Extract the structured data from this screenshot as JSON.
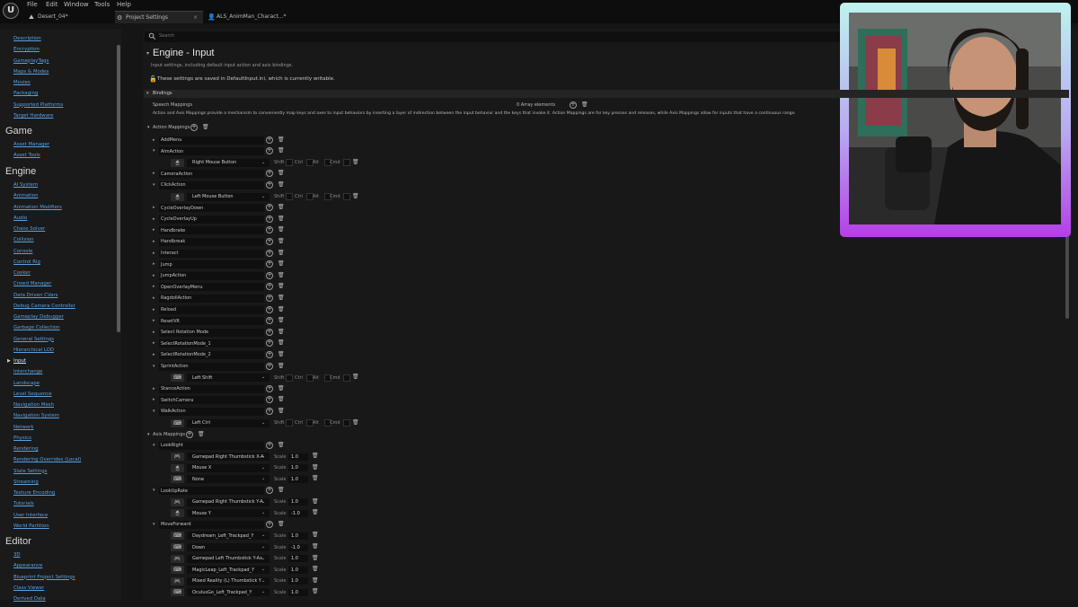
{
  "menu": [
    "File",
    "Edit",
    "Window",
    "Tools",
    "Help"
  ],
  "tabs": [
    {
      "label": "Desert_04*",
      "icon": "⛰"
    },
    {
      "label": "Project Settings",
      "icon": "⚙"
    },
    {
      "label": "ALS_AnimMan_Charact...*",
      "icon": "👤"
    }
  ],
  "sidebar": {
    "top_links": [
      "Description",
      "Encryption",
      "GameplayTags",
      "Maps & Modes",
      "Movies",
      "Packaging",
      "Supported Platforms",
      "Target Hardware"
    ],
    "sections": [
      {
        "title": "Game",
        "links": [
          "Asset Manager",
          "Asset Tools"
        ]
      },
      {
        "title": "Engine",
        "links": [
          "AI System",
          "Animation",
          "Animation Modifiers",
          "Audio",
          "Chaos Solver",
          "Collision",
          "Console",
          "Control Rig",
          "Cooker",
          "Crowd Manager",
          "Data Driven CVars",
          "Debug Camera Controller",
          "Gameplay Debugger",
          "Garbage Collection",
          "General Settings",
          "Hierarchical LOD",
          "Input",
          "Interchange",
          "Landscape",
          "Level Sequence",
          "Navigation Mesh",
          "Navigation System",
          "Network",
          "Physics",
          "Rendering",
          "Rendering Overrides (Local)",
          "Slate Settings",
          "Streaming",
          "Texture Encoding",
          "Tutorials",
          "User Interface",
          "World Partition"
        ]
      },
      {
        "title": "Editor",
        "links": [
          "3D",
          "Appearance",
          "Blueprint Project Settings",
          "Class Viewer",
          "Derived Data"
        ]
      }
    ]
  },
  "search": {
    "placeholder": "Search"
  },
  "page": {
    "title": "Engine - Input",
    "subtitle": "Input settings, including default input action and axis bindings.",
    "notice": "These settings are saved in DefaultInput.ini, which is currently writable."
  },
  "bindings": {
    "header": "Bindings",
    "speech_label": "Speech Mappings",
    "speech_count": "0 Array elements",
    "description": "Action and Axis Mappings provide a mechanism to conveniently map keys and axes to input behaviors by inserting a layer of indirection between the input behavior and the keys that invoke it. Action Mappings are for key presses and releases, while Axis Mappings allow for inputs that have a continuous range.",
    "action_header": "Action Mappings",
    "axis_header": "Axis Mappings",
    "modifiers": [
      "Shift",
      "Ctrl",
      "Alt",
      "Cmd"
    ],
    "scale_label": "Scale"
  },
  "action_mappings": [
    {
      "name": "AddMenu",
      "expanded": false,
      "keys": []
    },
    {
      "name": "AimAction",
      "expanded": true,
      "keys": [
        {
          "icon": "mouse",
          "key": "Right Mouse Button"
        }
      ]
    },
    {
      "name": "CameraAction",
      "expanded": false,
      "keys": []
    },
    {
      "name": "ClickAction",
      "expanded": true,
      "keys": [
        {
          "icon": "mouse",
          "key": "Left Mouse Button"
        }
      ]
    },
    {
      "name": "CycleOverlayDown",
      "expanded": false,
      "keys": []
    },
    {
      "name": "CycleOverlayUp",
      "expanded": false,
      "keys": []
    },
    {
      "name": "Handbrake",
      "expanded": false,
      "keys": []
    },
    {
      "name": "Handbreak",
      "expanded": false,
      "keys": []
    },
    {
      "name": "Interact",
      "expanded": false,
      "keys": []
    },
    {
      "name": "Jump",
      "expanded": false,
      "keys": []
    },
    {
      "name": "JumpAction",
      "expanded": false,
      "keys": []
    },
    {
      "name": "OpenOverlayMenu",
      "expanded": false,
      "keys": []
    },
    {
      "name": "RagdollAction",
      "expanded": false,
      "keys": []
    },
    {
      "name": "Reload",
      "expanded": false,
      "keys": []
    },
    {
      "name": "ResetVR",
      "expanded": false,
      "keys": []
    },
    {
      "name": "Select Rotation Mode",
      "expanded": false,
      "keys": []
    },
    {
      "name": "SelectRotationMode_1",
      "expanded": false,
      "keys": []
    },
    {
      "name": "SelectRotationMode_2",
      "expanded": false,
      "keys": []
    },
    {
      "name": "SprintAction",
      "expanded": true,
      "keys": [
        {
          "icon": "keyboard",
          "key": "Left Shift"
        }
      ]
    },
    {
      "name": "StanceAction",
      "expanded": false,
      "keys": []
    },
    {
      "name": "SwitchCamera",
      "expanded": false,
      "keys": []
    },
    {
      "name": "WalkAction",
      "expanded": true,
      "keys": [
        {
          "icon": "keyboard",
          "key": "Left Ctrl"
        }
      ]
    }
  ],
  "axis_mappings": [
    {
      "name": "LookRight",
      "keys": [
        {
          "icon": "gamepad",
          "key": "Gamepad Right Thumbstick X-A",
          "scale": "1.0"
        },
        {
          "icon": "mouse",
          "key": "Mouse X",
          "scale": "1.0"
        },
        {
          "icon": "keyboard",
          "key": "None",
          "scale": "1.0"
        }
      ]
    },
    {
      "name": "LookUpRate",
      "keys": [
        {
          "icon": "gamepad",
          "key": "Gamepad Right Thumbstick Y-A",
          "scale": "1.0"
        },
        {
          "icon": "mouse",
          "key": "Mouse Y",
          "scale": "-1.0"
        }
      ]
    },
    {
      "name": "MoveForward",
      "keys": [
        {
          "icon": "keyboard",
          "key": "Daydream_Left_Trackpad_Y",
          "scale": "1.0"
        },
        {
          "icon": "keyboard",
          "key": "Down",
          "scale": "-1.0"
        },
        {
          "icon": "gamepad",
          "key": "Gamepad Left Thumbstick Y-Ax",
          "scale": "1.0"
        },
        {
          "icon": "keyboard",
          "key": "MagicLeap_Left_Trackpad_Y",
          "scale": "1.0"
        },
        {
          "icon": "gamepad",
          "key": "Mixed Reality (L) Thumbstick Y",
          "scale": "1.0"
        },
        {
          "icon": "keyboard",
          "key": "OculusGo_Left_Trackpad_Y",
          "scale": "1.0"
        }
      ]
    }
  ],
  "icons": {
    "mouse": "🖱",
    "keyboard": "⌨",
    "gamepad": "🎮",
    "add": "⊕",
    "delete": "🗑",
    "lock": "🔓"
  }
}
